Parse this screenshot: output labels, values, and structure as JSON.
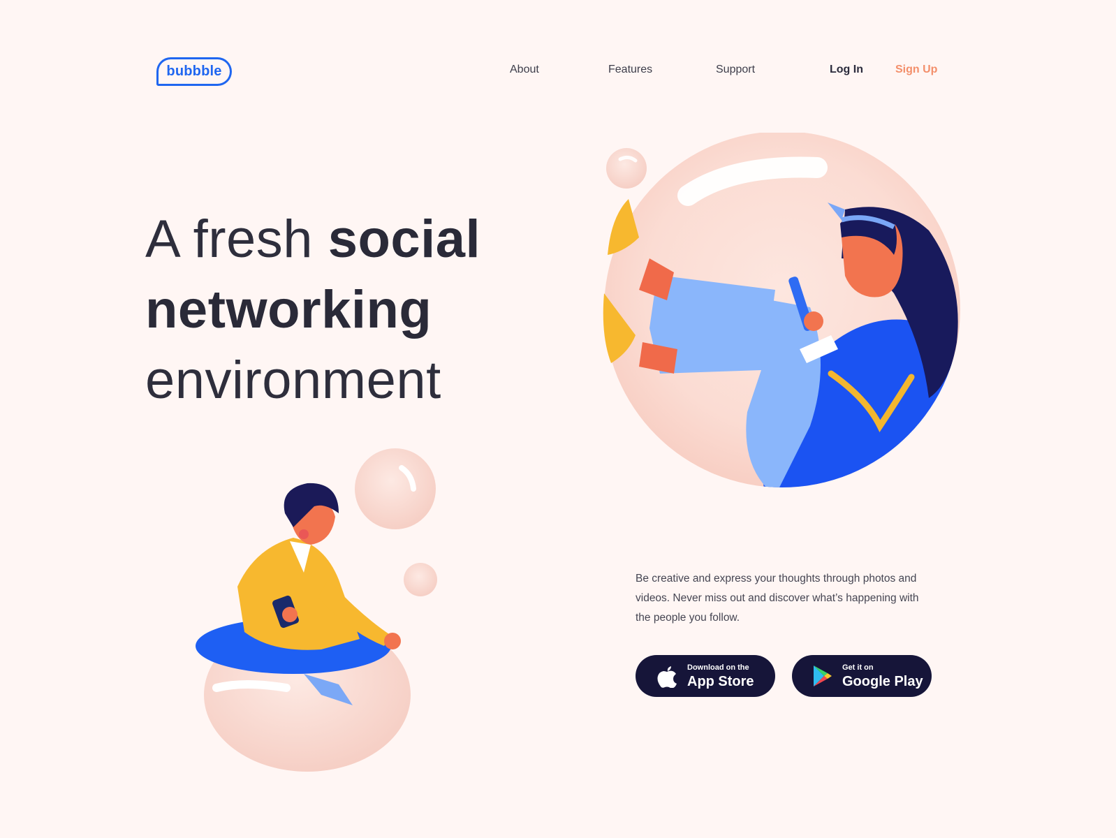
{
  "brand": {
    "logo_text": "bubbble",
    "accent": "#1f66f0"
  },
  "nav": {
    "links": [
      {
        "label": "About"
      },
      {
        "label": "Features"
      },
      {
        "label": "Support"
      }
    ],
    "login_label": "Log In",
    "signup_label": "Sign Up",
    "signup_color": "#f38f6b"
  },
  "hero": {
    "headline": {
      "part1": "A fresh ",
      "part2": "social",
      "line2": "networking",
      "line3": "environment"
    },
    "description": "Be creative and express your thoughts through photos and videos. Never miss out and discover what’s happening with the people you follow."
  },
  "store_buttons": {
    "appstore": {
      "small": "Download on the",
      "big": "App Store",
      "icon": "apple-icon"
    },
    "google": {
      "small": "Get it on",
      "big": "Google Play",
      "icon": "google-play-icon"
    }
  },
  "colors": {
    "background": "#fff6f4",
    "button_bg": "#161539",
    "text_dark": "#2a2a38"
  }
}
